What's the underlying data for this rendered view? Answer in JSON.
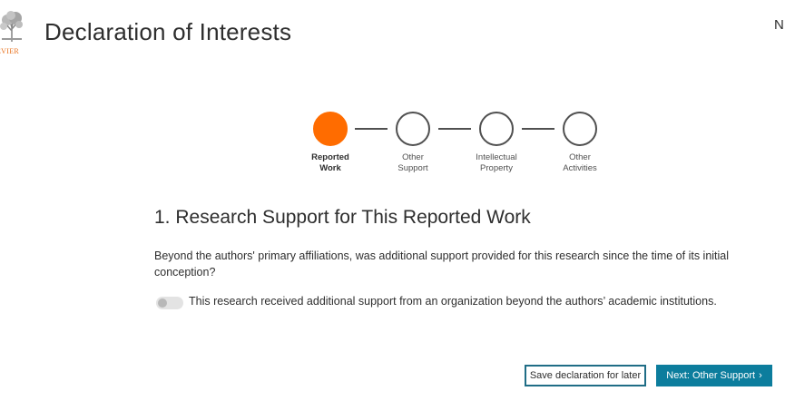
{
  "header": {
    "logo_text": "EVIER",
    "title": "Declaration of Interests",
    "right_text": "N"
  },
  "stepper": {
    "steps": [
      {
        "label_line1": "Reported",
        "label_line2": "Work",
        "state": "active"
      },
      {
        "label_line1": "Other",
        "label_line2": "Support",
        "state": "pending"
      },
      {
        "label_line1": "Intellectual",
        "label_line2": "Property",
        "state": "pending"
      },
      {
        "label_line1": "Other",
        "label_line2": "Activities",
        "state": "pending"
      }
    ],
    "active_color": "#ff6c00"
  },
  "section": {
    "title": "1. Research Support for This Reported Work",
    "question": "Beyond the authors' primary affiliations, was additional support provided for this research since the time of its initial conception?",
    "toggle": {
      "label": "This research received additional support from an organization beyond the authors’ academic institutions.",
      "checked": false
    }
  },
  "actions": {
    "save_label": "Save declaration for later",
    "next_label": "Next: Other Support",
    "accent_color": "#0c7d9d"
  }
}
